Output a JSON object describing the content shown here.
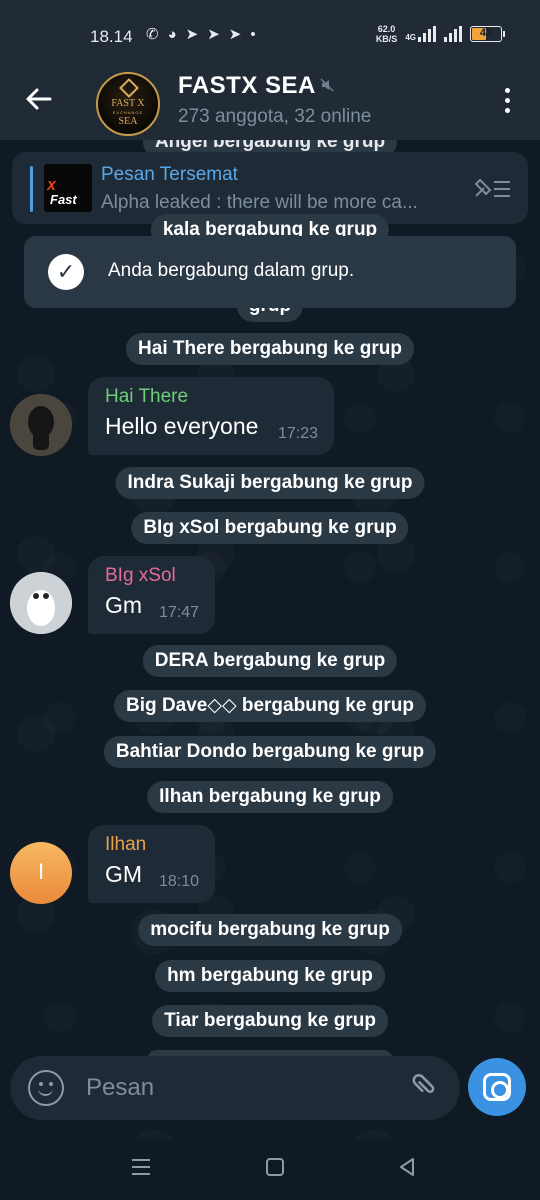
{
  "status_bar": {
    "time": "18.14",
    "notif_icons": [
      "whatsapp-icon",
      "discord-icon",
      "telegram-icon",
      "telegram-icon",
      "telegram-icon",
      "dot-icon"
    ],
    "speed_value": "62.0",
    "speed_unit": "KB/S",
    "network": "4G",
    "battery": "43"
  },
  "header": {
    "avatar_line1": "FAST X",
    "avatar_line2": "EXCHANGE",
    "avatar_line3": "SEA",
    "title": "FASTX SEA",
    "subtitle": "273 anggota, 32 online"
  },
  "pinned": {
    "thumb_text": "Fast",
    "thumb_accent": "X",
    "title": "Pesan Tersemat",
    "text": "Alpha leaked :  there will be more ca..."
  },
  "toast": {
    "text": "Anda bergabung dalam grup."
  },
  "service_messages": {
    "angel": "Angel bergabung ke grup",
    "kala": "kala bergabung ke grup",
    "clipped": "grup",
    "hai": "Hai There bergabung ke grup",
    "indra": "Indra Sukaji bergabung ke grup",
    "big_xsol": "BIg xSol bergabung ke grup",
    "dera": "DERA bergabung ke grup",
    "big_dave": "Big Dave◇◇ bergabung ke grup",
    "bahtiar": "Bahtiar Dondo bergabung ke grup",
    "ilhan": "Ilhan bergabung ke grup",
    "mocifu": "mocifu bergabung ke grup",
    "hm": "hm bergabung ke grup",
    "tiar": "Tiar bergabung ke grup"
  },
  "messages": [
    {
      "sender": "Hai There",
      "sender_color": "#6fcf7a",
      "text": "Hello everyone",
      "time": "17:23"
    },
    {
      "sender": "BIg xSol",
      "sender_color": "#e36c9f",
      "text": "Gm",
      "time": "17:47"
    },
    {
      "sender": "Ilhan",
      "sender_color": "#e9a24a",
      "text": "GM",
      "time": "18:10",
      "avatar_letter": "I"
    }
  ],
  "composer": {
    "placeholder": "Pesan"
  },
  "colors": {
    "header_bg": "#202b36",
    "chat_bg": "#0f1a24",
    "bubble_bg": "#1e2a35",
    "accent": "#3b92e2"
  }
}
